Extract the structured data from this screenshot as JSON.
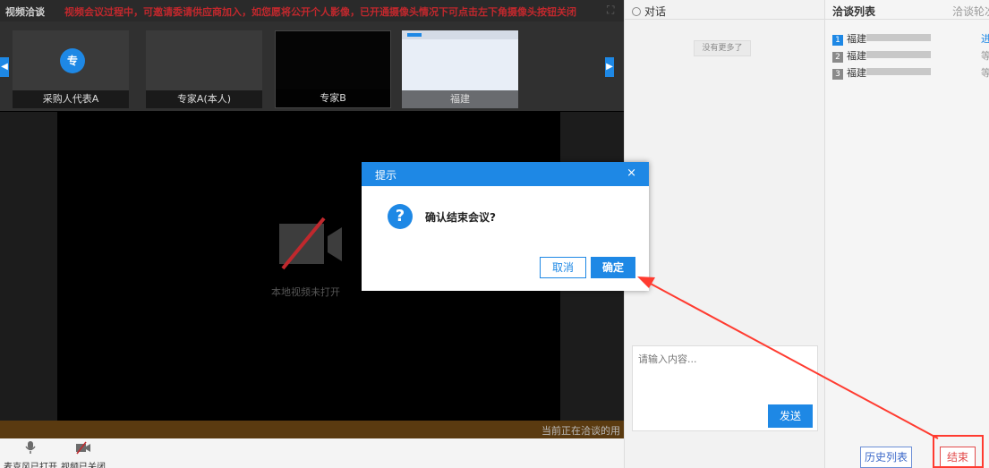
{
  "video": {
    "title": "视频洽谈",
    "notice": "视频会议过程中，可邀请委请供应商加入，如您愿将公开个人影像，已开通摄像头情况下可点击左下角摄像头按钮关闭",
    "thumbnails": [
      {
        "avatar_text": "专",
        "caption": "采购人代表A"
      },
      {
        "caption": "专家A(本人)"
      },
      {
        "caption": "专家B"
      },
      {
        "caption": "福建"
      }
    ],
    "camera_off_text": "本地视频未打开",
    "status_text": "当前正在洽谈的用",
    "controls": {
      "mic_label": "麦克风已打开",
      "camera_label": "视频已关闭"
    }
  },
  "chat": {
    "title": "对话",
    "no_more": "没有更多了",
    "input_placeholder": "请输入内容...",
    "send_label": "发送"
  },
  "list": {
    "title": "洽谈列表",
    "title2": "洽谈轮次",
    "rows": [
      {
        "num": "1",
        "name": "福建",
        "status": "进",
        "num_color": "#1e88e5",
        "status_color": "#1e88e5"
      },
      {
        "num": "2",
        "name": "福建",
        "status": "等",
        "num_color": "#8a8a8a",
        "status_color": "#999999"
      },
      {
        "num": "3",
        "name": "福建",
        "status": "等",
        "num_color": "#8a8a8a",
        "status_color": "#999999"
      }
    ],
    "history_label": "历史列表",
    "end_label": "结束"
  },
  "modal": {
    "title": "提示",
    "close": "×",
    "icon": "?",
    "message": "确认结束会议?",
    "cancel_label": "取消",
    "ok_label": "确定"
  }
}
